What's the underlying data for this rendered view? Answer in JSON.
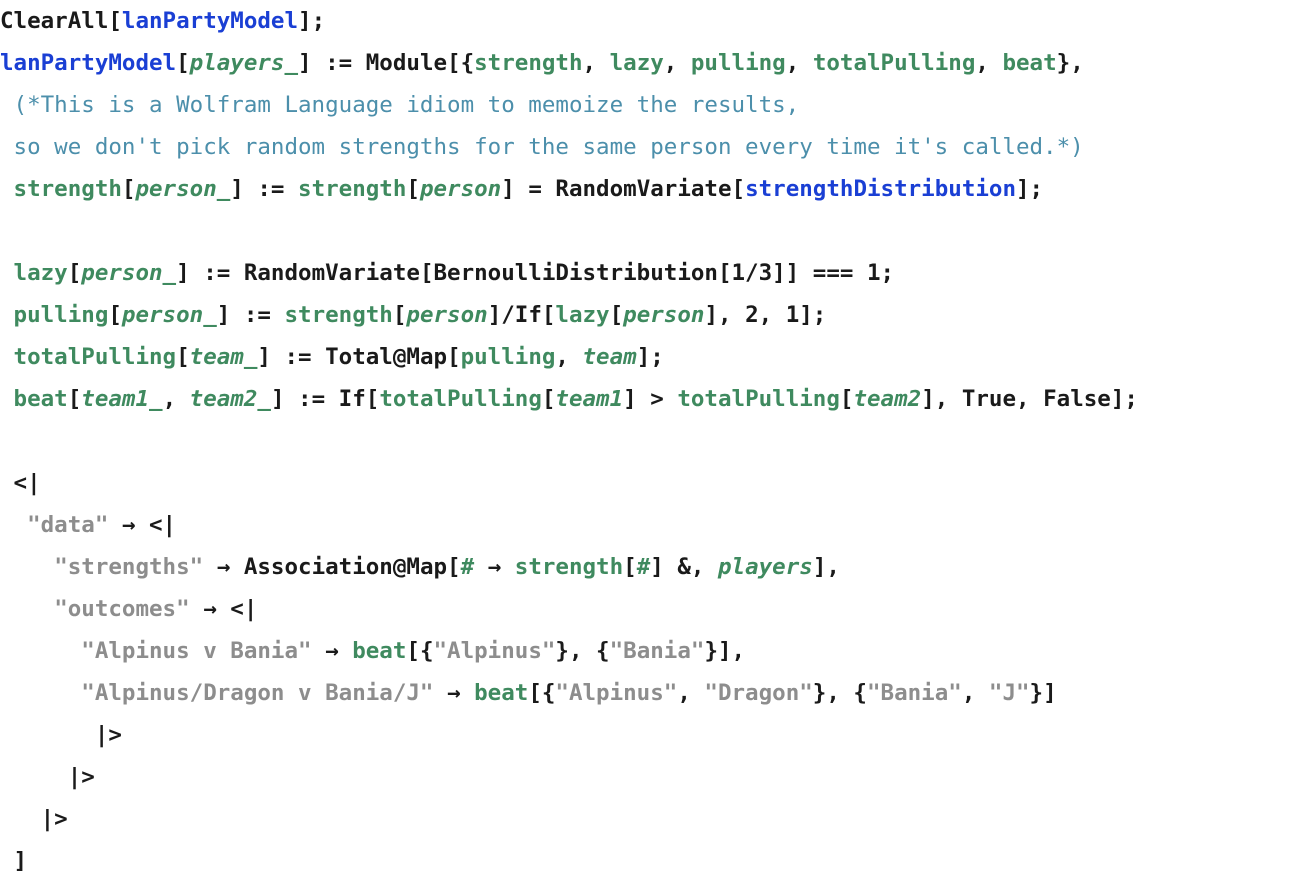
{
  "editor": {
    "language": "Wolfram Language",
    "font_weight": "bold",
    "background": "#ffffff",
    "colors": {
      "plain": "#1a1a1a",
      "local_symbol": "#3f8a5f",
      "global_symbol": "#1a3fd4",
      "string": "#8d8d8d",
      "comment": "#4c8fab"
    }
  },
  "code_lines": [
    {
      "indent": 0,
      "tokens": [
        {
          "text": "ClearAll[",
          "kind": "plain"
        },
        {
          "text": "lanPartyModel",
          "kind": "global"
        },
        {
          "text": "];",
          "kind": "plain"
        }
      ]
    },
    {
      "indent": 0,
      "tokens": [
        {
          "text": "lanPartyModel",
          "kind": "global"
        },
        {
          "text": "[",
          "kind": "plain"
        },
        {
          "text": "players_",
          "kind": "local",
          "italic": true
        },
        {
          "text": "] := Module[{",
          "kind": "plain"
        },
        {
          "text": "strength",
          "kind": "local"
        },
        {
          "text": ", ",
          "kind": "plain"
        },
        {
          "text": "lazy",
          "kind": "local"
        },
        {
          "text": ", ",
          "kind": "plain"
        },
        {
          "text": "pulling",
          "kind": "local"
        },
        {
          "text": ", ",
          "kind": "plain"
        },
        {
          "text": "totalPulling",
          "kind": "local"
        },
        {
          "text": ", ",
          "kind": "plain"
        },
        {
          "text": "beat",
          "kind": "local"
        },
        {
          "text": "},",
          "kind": "plain"
        }
      ]
    },
    {
      "indent": 1,
      "tokens": [
        {
          "text": "(*This is a Wolfram Language idiom to memoize the results,",
          "kind": "comment"
        }
      ]
    },
    {
      "indent": 1,
      "tokens": [
        {
          "text": "so we don't pick random strengths for the same person every time it's called.*)",
          "kind": "comment"
        }
      ]
    },
    {
      "indent": 1,
      "tokens": [
        {
          "text": "strength",
          "kind": "local"
        },
        {
          "text": "[",
          "kind": "plain"
        },
        {
          "text": "person_",
          "kind": "local",
          "italic": true
        },
        {
          "text": "] := ",
          "kind": "plain"
        },
        {
          "text": "strength",
          "kind": "local"
        },
        {
          "text": "[",
          "kind": "plain"
        },
        {
          "text": "person",
          "kind": "local",
          "italic": true
        },
        {
          "text": "] = RandomVariate[",
          "kind": "plain"
        },
        {
          "text": "strengthDistribution",
          "kind": "global"
        },
        {
          "text": "];",
          "kind": "plain"
        }
      ]
    },
    {
      "indent": 0,
      "tokens": []
    },
    {
      "indent": 1,
      "tokens": [
        {
          "text": "lazy",
          "kind": "local"
        },
        {
          "text": "[",
          "kind": "plain"
        },
        {
          "text": "person_",
          "kind": "local",
          "italic": true
        },
        {
          "text": "] := RandomVariate[BernoulliDistribution[1/3]] === 1;",
          "kind": "plain"
        }
      ]
    },
    {
      "indent": 1,
      "tokens": [
        {
          "text": "pulling",
          "kind": "local"
        },
        {
          "text": "[",
          "kind": "plain"
        },
        {
          "text": "person_",
          "kind": "local",
          "italic": true
        },
        {
          "text": "] := ",
          "kind": "plain"
        },
        {
          "text": "strength",
          "kind": "local"
        },
        {
          "text": "[",
          "kind": "plain"
        },
        {
          "text": "person",
          "kind": "local",
          "italic": true
        },
        {
          "text": "]/If[",
          "kind": "plain"
        },
        {
          "text": "lazy",
          "kind": "local"
        },
        {
          "text": "[",
          "kind": "plain"
        },
        {
          "text": "person",
          "kind": "local",
          "italic": true
        },
        {
          "text": "], 2, 1];",
          "kind": "plain"
        }
      ]
    },
    {
      "indent": 1,
      "tokens": [
        {
          "text": "totalPulling",
          "kind": "local"
        },
        {
          "text": "[",
          "kind": "plain"
        },
        {
          "text": "team_",
          "kind": "local",
          "italic": true
        },
        {
          "text": "] := Total@Map[",
          "kind": "plain"
        },
        {
          "text": "pulling",
          "kind": "local"
        },
        {
          "text": ", ",
          "kind": "plain"
        },
        {
          "text": "team",
          "kind": "local",
          "italic": true
        },
        {
          "text": "];",
          "kind": "plain"
        }
      ]
    },
    {
      "indent": 1,
      "tokens": [
        {
          "text": "beat",
          "kind": "local"
        },
        {
          "text": "[",
          "kind": "plain"
        },
        {
          "text": "team1_",
          "kind": "local",
          "italic": true
        },
        {
          "text": ", ",
          "kind": "plain"
        },
        {
          "text": "team2_",
          "kind": "local",
          "italic": true
        },
        {
          "text": "] := If[",
          "kind": "plain"
        },
        {
          "text": "totalPulling",
          "kind": "local"
        },
        {
          "text": "[",
          "kind": "plain"
        },
        {
          "text": "team1",
          "kind": "local",
          "italic": true
        },
        {
          "text": "] > ",
          "kind": "plain"
        },
        {
          "text": "totalPulling",
          "kind": "local"
        },
        {
          "text": "[",
          "kind": "plain"
        },
        {
          "text": "team2",
          "kind": "local",
          "italic": true
        },
        {
          "text": "], True, False];",
          "kind": "plain"
        }
      ]
    },
    {
      "indent": 0,
      "tokens": []
    },
    {
      "indent": 1,
      "tokens": [
        {
          "text": "<|",
          "kind": "plain"
        }
      ]
    },
    {
      "indent": 2,
      "tokens": [
        {
          "text": "\"data\"",
          "kind": "string"
        },
        {
          "text": " → <|",
          "kind": "plain"
        }
      ]
    },
    {
      "indent": 4,
      "tokens": [
        {
          "text": "\"strengths\"",
          "kind": "string"
        },
        {
          "text": " → Association@Map[",
          "kind": "plain"
        },
        {
          "text": "#",
          "kind": "local"
        },
        {
          "text": " → ",
          "kind": "plain"
        },
        {
          "text": "strength",
          "kind": "local"
        },
        {
          "text": "[",
          "kind": "plain"
        },
        {
          "text": "#",
          "kind": "local"
        },
        {
          "text": "] &, ",
          "kind": "plain"
        },
        {
          "text": "players",
          "kind": "local",
          "italic": true
        },
        {
          "text": "],",
          "kind": "plain"
        }
      ]
    },
    {
      "indent": 4,
      "tokens": [
        {
          "text": "\"outcomes\"",
          "kind": "string"
        },
        {
          "text": " → <|",
          "kind": "plain"
        }
      ]
    },
    {
      "indent": 6,
      "tokens": [
        {
          "text": "\"Alpinus v Bania\"",
          "kind": "string"
        },
        {
          "text": " → ",
          "kind": "plain"
        },
        {
          "text": "beat",
          "kind": "local"
        },
        {
          "text": "[{",
          "kind": "plain"
        },
        {
          "text": "\"Alpinus\"",
          "kind": "string"
        },
        {
          "text": "}, {",
          "kind": "plain"
        },
        {
          "text": "\"Bania\"",
          "kind": "string"
        },
        {
          "text": "}],",
          "kind": "plain"
        }
      ]
    },
    {
      "indent": 6,
      "tokens": [
        {
          "text": "\"Alpinus/Dragon v Bania/J\"",
          "kind": "string"
        },
        {
          "text": " → ",
          "kind": "plain"
        },
        {
          "text": "beat",
          "kind": "local"
        },
        {
          "text": "[{",
          "kind": "plain"
        },
        {
          "text": "\"Alpinus\"",
          "kind": "string"
        },
        {
          "text": ", ",
          "kind": "plain"
        },
        {
          "text": "\"Dragon\"",
          "kind": "string"
        },
        {
          "text": "}, {",
          "kind": "plain"
        },
        {
          "text": "\"Bania\"",
          "kind": "string"
        },
        {
          "text": ", ",
          "kind": "plain"
        },
        {
          "text": "\"J\"",
          "kind": "string"
        },
        {
          "text": "}]",
          "kind": "plain"
        }
      ]
    },
    {
      "indent": 7,
      "tokens": [
        {
          "text": "|>",
          "kind": "plain"
        }
      ]
    },
    {
      "indent": 5,
      "tokens": [
        {
          "text": "|>",
          "kind": "plain"
        }
      ]
    },
    {
      "indent": 3,
      "tokens": [
        {
          "text": "|>",
          "kind": "plain"
        }
      ]
    },
    {
      "indent": 1,
      "tokens": [
        {
          "text": "]",
          "kind": "plain"
        }
      ]
    }
  ]
}
